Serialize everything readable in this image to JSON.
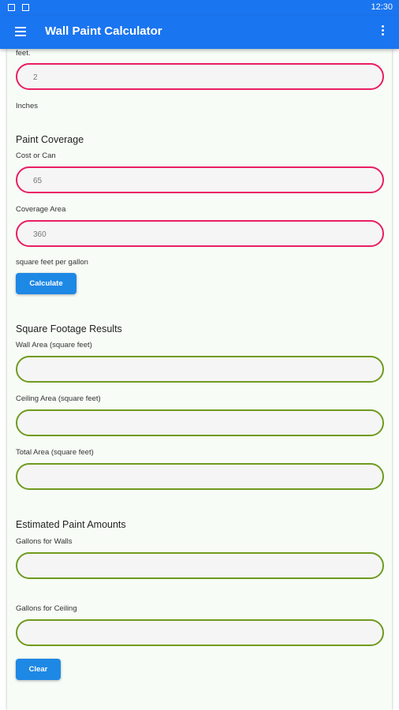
{
  "status_bar": {
    "time": "12:30"
  },
  "app_bar": {
    "title": "Wall Paint Calculator"
  },
  "form": {
    "feet_label": "feet.",
    "inches_value": "2",
    "inches_label": "Inches",
    "paint_coverage_heading": "Paint Coverage",
    "cost_label": "Cost or Can",
    "cost_value": "65",
    "coverage_label": "Coverage Area",
    "coverage_value": "360",
    "coverage_unit": "square feet per gallon",
    "calculate_label": "Calculate"
  },
  "results": {
    "heading": "Square Footage Results",
    "wall_label": "Wall Area (square feet)",
    "wall_value": "",
    "ceiling_label": "Ceiling Area (square feet)",
    "ceiling_value": "",
    "total_label": "Total Area (square feet)",
    "total_value": ""
  },
  "estimates": {
    "heading": "Estimated Paint Amounts",
    "walls_label": "Gallons for Walls",
    "walls_value": "",
    "ceiling_label": "Gallons for Ceiling",
    "ceiling_value": "",
    "clear_label": "Clear"
  }
}
